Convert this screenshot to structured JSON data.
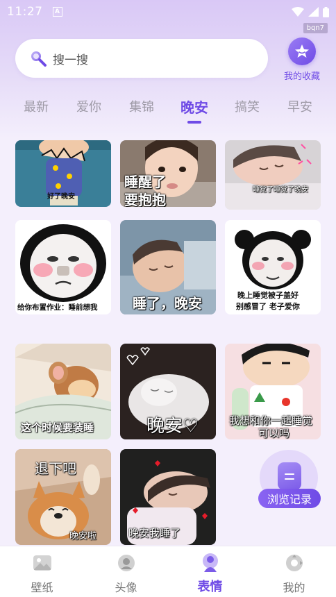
{
  "status_bar": {
    "time": "11:27",
    "indicator": "A"
  },
  "debug_tag": "bqn7",
  "search": {
    "placeholder": "搜一搜"
  },
  "favorites": {
    "label": "我的收藏"
  },
  "tabs": [
    {
      "label": "最新",
      "active": false
    },
    {
      "label": "爱你",
      "active": false
    },
    {
      "label": "集锦",
      "active": false
    },
    {
      "label": "晚安",
      "active": true
    },
    {
      "label": "搞笑",
      "active": false
    },
    {
      "label": "早安",
      "active": false
    }
  ],
  "grid": [
    {
      "name": "cartoon-sleeping",
      "caption": "好了晚安"
    },
    {
      "name": "baby-awake",
      "caption_lines": [
        "睡醒了",
        "要抱抱"
      ]
    },
    {
      "name": "baby-sleeping",
      "caption": "睡觉了睡觉了晚安"
    },
    {
      "name": "panda-homework",
      "caption": "给你布置作业：睡前想我"
    },
    {
      "name": "baby-goodnight",
      "caption": "睡了，晚安"
    },
    {
      "name": "panda-blanket",
      "caption_lines": [
        "晚上睡觉被子盖好",
        "别感冒了 老子爱你"
      ]
    },
    {
      "name": "jerry-sleep",
      "caption": "这个时候要装睡"
    },
    {
      "name": "cat-goodnight",
      "caption": "晚安♡"
    },
    {
      "name": "shinchan-sleep",
      "caption_lines": [
        "我想和你一起睡觉",
        "可以吗"
      ]
    },
    {
      "name": "shiba-dismissed",
      "caption_top": "退下吧",
      "caption": "晚安啦"
    },
    {
      "name": "baby-in-arms",
      "caption": "晚安我睡了"
    }
  ],
  "history_button": {
    "label": "浏览记录"
  },
  "bottom_nav": [
    {
      "label": "壁纸",
      "icon": "wallpaper-icon",
      "active": false
    },
    {
      "label": "头像",
      "icon": "avatar-icon",
      "active": false
    },
    {
      "label": "表情",
      "icon": "sticker-icon",
      "active": true
    },
    {
      "label": "我的",
      "icon": "profile-icon",
      "active": false
    }
  ],
  "colors": {
    "accent": "#6f4be6",
    "header_bg": "#d9c8f6",
    "page_bg": "#f4effc"
  }
}
